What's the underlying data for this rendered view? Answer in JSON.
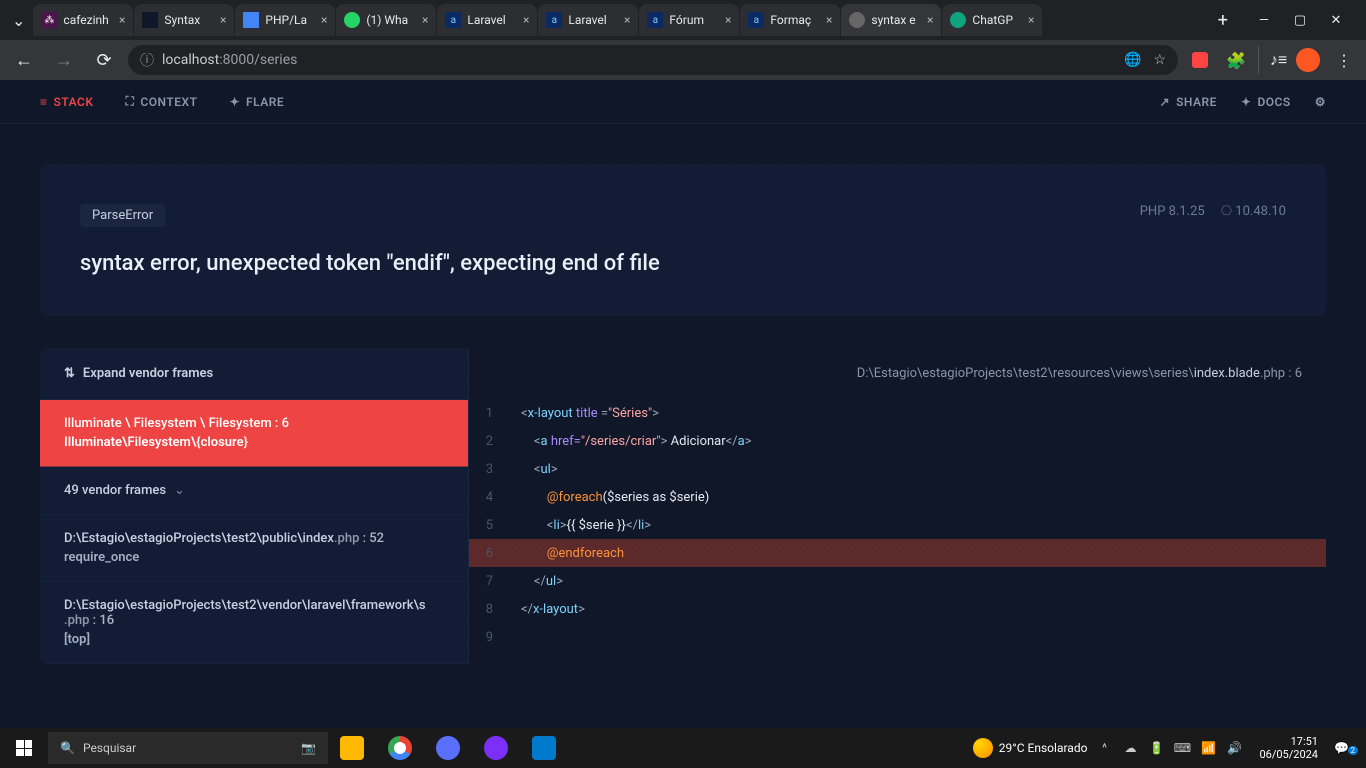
{
  "browser": {
    "tabs": [
      {
        "title": "cafezinh",
        "iconBg": "#4a154b"
      },
      {
        "title": "Syntax",
        "iconBg": "#0f1729"
      },
      {
        "title": "PHP/La",
        "iconBg": "#4285f4"
      },
      {
        "title": "(1) Wha",
        "iconBg": "#25d366"
      },
      {
        "title": "Laravel",
        "iconBg": "#0b2a63"
      },
      {
        "title": "Laravel",
        "iconBg": "#0b2a63"
      },
      {
        "title": "Fórum",
        "iconBg": "#0b2a63"
      },
      {
        "title": "Formaç",
        "iconBg": "#0b2a63"
      },
      {
        "title": "syntax e",
        "iconBg": "#666",
        "active": true
      },
      {
        "title": "ChatGP",
        "iconBg": "#10a37f"
      }
    ],
    "url_host": "localhost",
    "url_port": ":8000",
    "url_path": "/series"
  },
  "ignition": {
    "nav": {
      "stack": "STACK",
      "context": "CONTEXT",
      "flare": "FLARE",
      "share": "SHARE",
      "docs": "DOCS"
    },
    "error": {
      "badge": "ParseError",
      "title": "syntax error, unexpected token \"endif\", expecting end of file",
      "php": "PHP 8.1.25",
      "laravel": "10.48.10"
    },
    "frames": {
      "expand": "Expand vendor frames",
      "active": {
        "path": "Illuminate \\ Filesystem \\ Filesystem : 6",
        "sub": "Illuminate\\Filesystem\\{closure}"
      },
      "vendor": "49 vendor frames",
      "f2": {
        "path_pre": "D:\\Estagio\\estagioProjects\\test2\\public\\index",
        "ext": ".php",
        "line": " : 52",
        "sub": "require_once"
      },
      "f3": {
        "path_pre": "D:\\Estagio\\estagioProjects\\test2\\vendor\\laravel\\framework\\s",
        "ext": ".php",
        "line": " : 16",
        "sub": "[top]"
      }
    },
    "code": {
      "path_pre": "D:\\Estagio\\estagioProjects\\test2\\resources\\views\\series\\",
      "path_file": "index.blade",
      "path_ext": ".php",
      "path_line": " : 6",
      "lines": {
        "l1n": "1",
        "l2n": "2",
        "l3n": "3",
        "l4n": "4",
        "l5n": "5",
        "l6n": "6",
        "l7n": "7",
        "l8n": "8",
        "l9n": "9"
      },
      "tokens": {
        "xlayout_open": "<x-layout",
        "title_attr": " title ",
        "eq": "=",
        "q": "\"",
        "series_val": "Séries",
        "close": ">",
        "a_open": "<a",
        "href_attr": " href=",
        "href_val": "/series/criar",
        "adicionar": " Adicionar",
        "a_close": "</a>",
        "ul_open": "<ul>",
        "ul_close": "</ul>",
        "foreach_dir": "@foreach",
        "foreach_args": "($series as $serie)",
        "li_open": "<li>",
        "li_close": "</li>",
        "mustache": "{{ $serie }}",
        "endforeach": "@endforeach",
        "xlayout_close": "</x-layout>"
      }
    }
  },
  "taskbar": {
    "search": "Pesquisar",
    "weather": "29°C  Ensolarado",
    "time": "17:51",
    "date": "06/05/2024",
    "notif_count": "2"
  }
}
